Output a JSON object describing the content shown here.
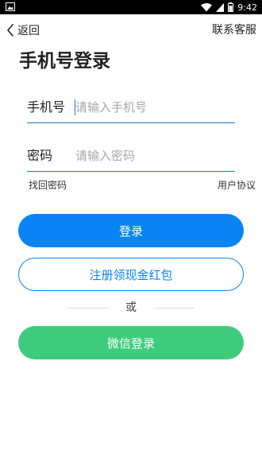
{
  "status_bar": {
    "time": "9:42",
    "left_icon": "image-icon",
    "icons": [
      "wifi-icon",
      "signal-icon",
      "battery-icon"
    ]
  },
  "nav": {
    "back_label": "返回",
    "service_label": "联系客服"
  },
  "page_title": "手机号登录",
  "form": {
    "phone": {
      "label": "手机号",
      "placeholder": "请输入手机号",
      "value": ""
    },
    "password": {
      "label": "密码",
      "placeholder": "请输入密码",
      "value": ""
    }
  },
  "links": {
    "forgot_password": "找回密码",
    "user_agreement": "用户协议"
  },
  "buttons": {
    "login": "登录",
    "register": "注册领现金红包",
    "wechat": "微信登录"
  },
  "divider_text": "或",
  "colors": {
    "primary": "#0a84f5",
    "wechat_green": "#3ecc7c",
    "underline": "#1a78d6"
  }
}
